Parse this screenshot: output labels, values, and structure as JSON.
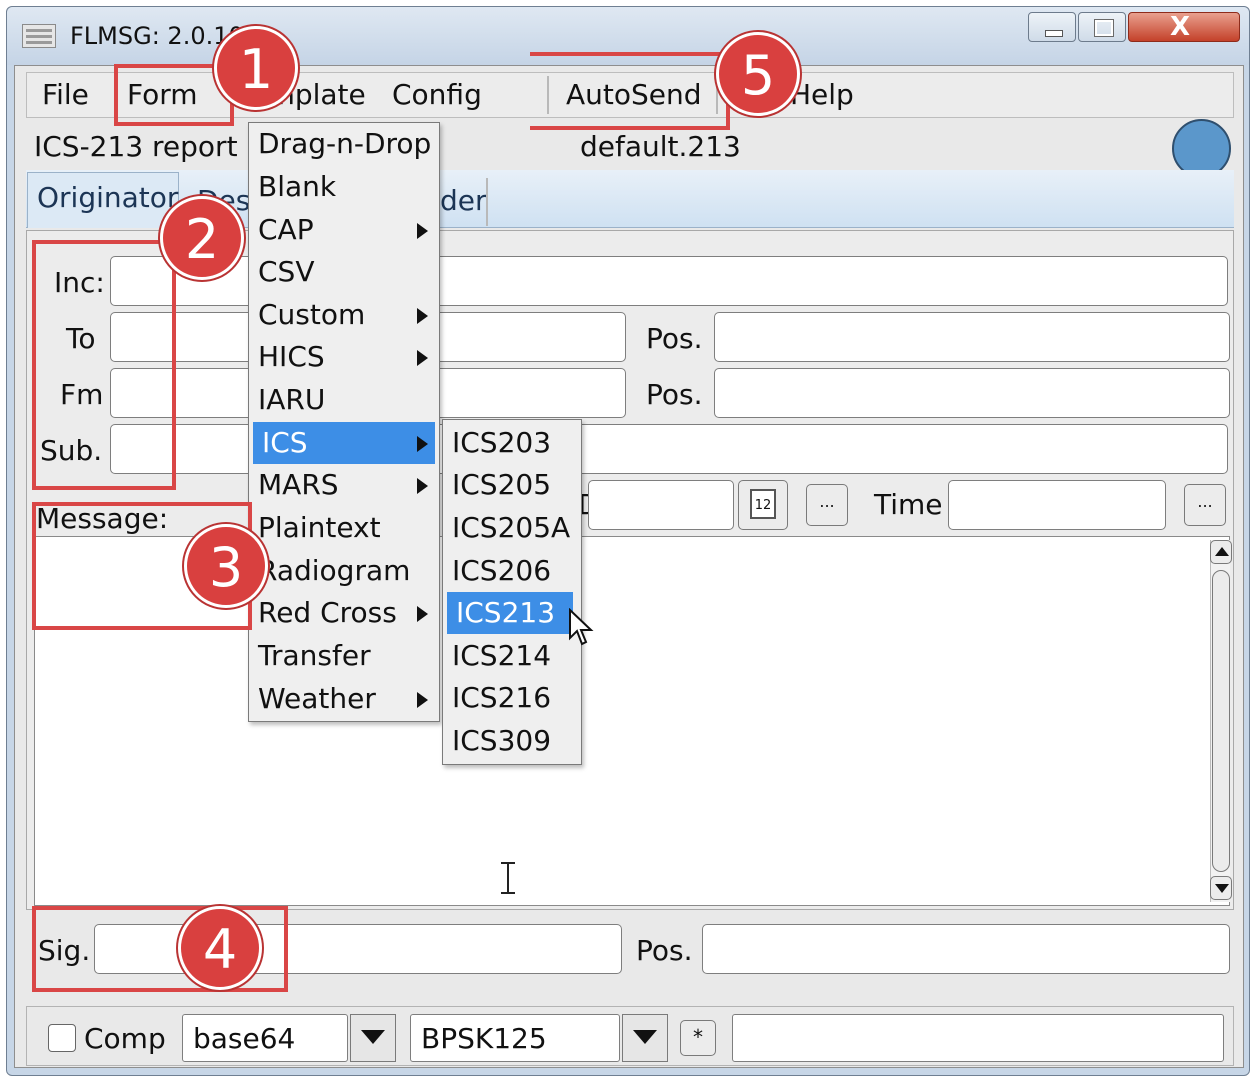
{
  "window": {
    "title": "FLMSG: 2.0.10",
    "close_glyph": "X"
  },
  "menubar": {
    "file": "File",
    "form": "Form",
    "template": "Template",
    "config": "Config",
    "autosend": "AutoSend",
    "help": "Help"
  },
  "header": {
    "report_name": "ICS-213 report",
    "file_name": "default.213",
    "status_color": "#5b97cb"
  },
  "tabs": [
    {
      "label": "Originator"
    },
    {
      "label": "Destination"
    },
    {
      "label": "Header"
    }
  ],
  "form": {
    "inc_label": "Inc:",
    "to_label": "To",
    "fm_label": "Fm",
    "sub_label": "Sub.",
    "pos_label": "Pos.",
    "date_label": "D",
    "time_label": "Time",
    "message_label": "Message:",
    "calendar_icon_text": "12",
    "ellipsis": "...",
    "inc_value": "",
    "to_value": "",
    "to_pos_value": "",
    "fm_value": "",
    "fm_pos_value": "",
    "sub_value": "",
    "date_value": "",
    "time_value": "",
    "message_value": ""
  },
  "signature": {
    "sig_label": "Sig.",
    "pos_label": "Pos.",
    "sig_value": "",
    "pos_value": ""
  },
  "bottom": {
    "comp_label": "Comp",
    "comp_checked": false,
    "encoding": "base64",
    "modem": "BPSK125",
    "star_label": "*",
    "status_value": ""
  },
  "form_menu": {
    "items": [
      {
        "label": "Drag-n-Drop",
        "submenu": false
      },
      {
        "label": "Blank",
        "submenu": false
      },
      {
        "label": "CAP",
        "submenu": true
      },
      {
        "label": "CSV",
        "submenu": false
      },
      {
        "label": "Custom",
        "submenu": true
      },
      {
        "label": "HICS",
        "submenu": true
      },
      {
        "label": "IARU",
        "submenu": false
      },
      {
        "label": "ICS",
        "submenu": true,
        "highlighted": true
      },
      {
        "label": "MARS",
        "submenu": true
      },
      {
        "label": "Plaintext",
        "submenu": false
      },
      {
        "label": "Radiogram",
        "submenu": false
      },
      {
        "label": "Red Cross",
        "submenu": true
      },
      {
        "label": "Transfer",
        "submenu": false
      },
      {
        "label": "Weather",
        "submenu": true
      }
    ]
  },
  "ics_submenu": {
    "items": [
      {
        "label": "ICS203"
      },
      {
        "label": "ICS205"
      },
      {
        "label": "ICS205A"
      },
      {
        "label": "ICS206"
      },
      {
        "label": "ICS213",
        "highlighted": true
      },
      {
        "label": "ICS214"
      },
      {
        "label": "ICS216"
      },
      {
        "label": "ICS309"
      }
    ]
  },
  "annotations": {
    "badge1": "1",
    "badge2": "2",
    "badge3": "3",
    "badge4": "4",
    "badge5": "5",
    "highlight_color": "#d94646"
  }
}
